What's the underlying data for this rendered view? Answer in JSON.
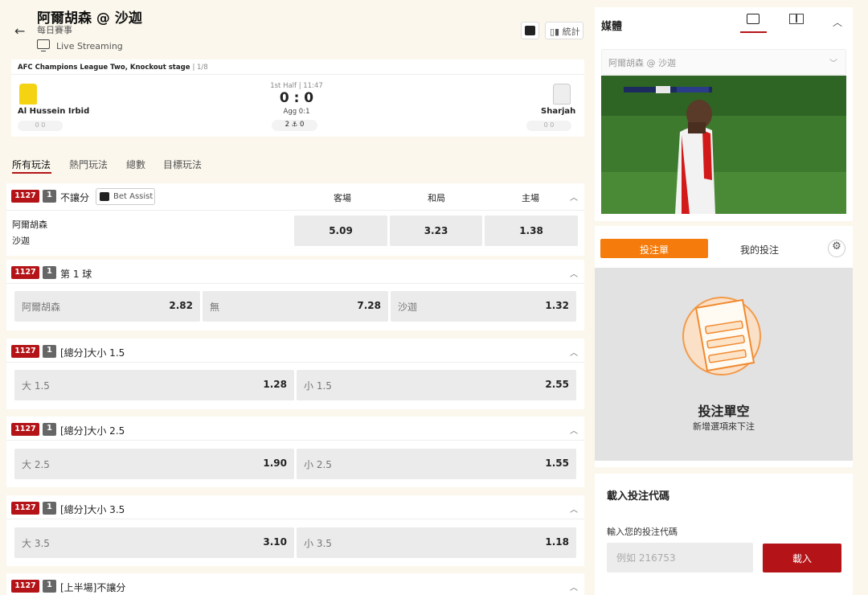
{
  "header": {
    "back_icon": "←",
    "title": "阿爾胡森 @ 沙迦",
    "subtitle": "每日賽事",
    "live_label": "Live Streaming",
    "stats_label": "統計"
  },
  "match": {
    "league": "AFC Champions League Two, Knockout stage",
    "round": "| 1/8",
    "home_name": "Al Hussein Irbid",
    "away_name": "Sharjah",
    "home_cards": "0  0",
    "away_cards": "0  0",
    "half_info": "1st Half | 11:47",
    "score": "0 : 0",
    "agg": "Agg 0:1",
    "corners": "2  ⚓  0"
  },
  "tabs": [
    "所有玩法",
    "熱門玩法",
    "總數",
    "目標玩法"
  ],
  "markets": {
    "moneyline": {
      "id": "1127",
      "num": "1",
      "title": "不讓分",
      "bet_assist": "Bet Assist",
      "cols": [
        "客場",
        "和局",
        "主場"
      ],
      "team1": "阿爾胡森",
      "team2": "沙迦",
      "odds": [
        "5.09",
        "3.23",
        "1.38"
      ]
    },
    "first_goal": {
      "id": "1127",
      "num": "1",
      "title": "第 1 球",
      "options": [
        {
          "label": "阿爾胡森",
          "odd": "2.82"
        },
        {
          "label": "無",
          "odd": "7.28"
        },
        {
          "label": "沙迦",
          "odd": "1.32"
        }
      ]
    },
    "ou15": {
      "id": "1127",
      "num": "1",
      "title": "[總分]大小 1.5",
      "options": [
        {
          "label": "大 1.5",
          "odd": "1.28"
        },
        {
          "label": "小 1.5",
          "odd": "2.55"
        }
      ]
    },
    "ou25": {
      "id": "1127",
      "num": "1",
      "title": "[總分]大小 2.5",
      "options": [
        {
          "label": "大 2.5",
          "odd": "1.90"
        },
        {
          "label": "小 2.5",
          "odd": "1.55"
        }
      ]
    },
    "ou35": {
      "id": "1127",
      "num": "1",
      "title": "[總分]大小 3.5",
      "options": [
        {
          "label": "大 3.5",
          "odd": "3.10"
        },
        {
          "label": "小 3.5",
          "odd": "1.18"
        }
      ]
    },
    "half_ml": {
      "id": "1127",
      "num": "1",
      "title": "[上半場]不讓分"
    }
  },
  "media": {
    "title": "媒體",
    "selected_match": "阿爾胡森 @ 沙迦"
  },
  "betslip": {
    "tab_active": "投注單",
    "tab_mine": "我的投注",
    "empty_title": "投注單空",
    "empty_sub": "新增選項來下注"
  },
  "load_code": {
    "title": "載入投注代碼",
    "label": "輸入您的投注代碼",
    "placeholder": "例如 216753",
    "button": "載入"
  },
  "colors": {
    "accent_red": "#b41418",
    "accent_orange": "#f57c0c"
  }
}
